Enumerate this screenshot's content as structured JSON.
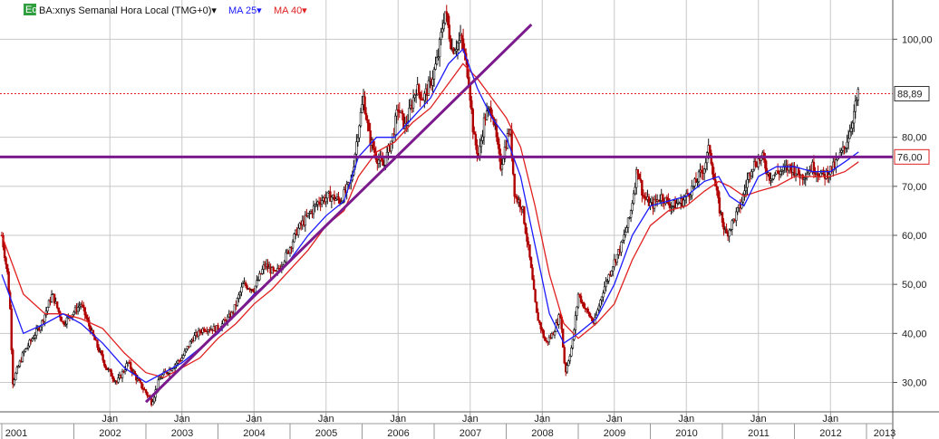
{
  "header": {
    "badge": "Eq",
    "symbol_label": "BA:xnys Semanal Hora Local (TMG+0)▾",
    "ma25_label": "MA 25▾",
    "ma40_label": "MA 40▾"
  },
  "colors": {
    "up_candle": "#111111",
    "down_candle": "#b00000",
    "ma25": "#1a1aff",
    "ma40": "#e02020",
    "trendline": "#7a1a8c",
    "support": "#7a1a8c",
    "price_line": "#e02020",
    "grid": "#c8c8c8",
    "badge_bg": "#2e9e3e"
  },
  "chart_data": {
    "type": "candlestick",
    "title": "BA:xnys Semanal Hora Local (TMG+0)",
    "ylim": [
      24,
      108
    ],
    "xlim": [
      2001.0,
      2013.2
    ],
    "grid": true,
    "y_ticks": [
      {
        "value": 30,
        "label": "30,00"
      },
      {
        "value": 40,
        "label": "40,00"
      },
      {
        "value": 50,
        "label": "50,00"
      },
      {
        "value": 60,
        "label": "60,00"
      },
      {
        "value": 70,
        "label": "70,00"
      },
      {
        "value": 80,
        "label": "80,00"
      },
      {
        "value": 100,
        "label": "100,00"
      }
    ],
    "x_year_labels": [
      {
        "t": 2001.0,
        "label": "2001"
      },
      {
        "t": 2002.0,
        "label": "2002"
      },
      {
        "t": 2003.0,
        "label": "2003"
      },
      {
        "t": 2004.0,
        "label": "2004"
      },
      {
        "t": 2005.0,
        "label": "2005"
      },
      {
        "t": 2006.0,
        "label": "2006"
      },
      {
        "t": 2007.0,
        "label": "2007"
      },
      {
        "t": 2008.0,
        "label": "2008"
      },
      {
        "t": 2009.0,
        "label": "2009"
      },
      {
        "t": 2010.0,
        "label": "2010"
      },
      {
        "t": 2011.0,
        "label": "2011"
      },
      {
        "t": 2012.0,
        "label": "2012"
      },
      {
        "t": 2013.0,
        "label": "2013"
      }
    ],
    "x_jan_labels": [
      {
        "t": 2002.0,
        "label": "Jan"
      },
      {
        "t": 2003.0,
        "label": "Jan"
      },
      {
        "t": 2004.0,
        "label": "Jan"
      },
      {
        "t": 2005.0,
        "label": "Jan"
      },
      {
        "t": 2006.0,
        "label": "Jan"
      },
      {
        "t": 2007.0,
        "label": "Jan"
      },
      {
        "t": 2008.0,
        "label": "Jan"
      },
      {
        "t": 2009.0,
        "label": "Jan"
      },
      {
        "t": 2010.0,
        "label": "Jan"
      },
      {
        "t": 2011.0,
        "label": "Jan"
      },
      {
        "t": 2012.0,
        "label": "Jan"
      }
    ],
    "price_path": [
      [
        2001.0,
        60
      ],
      [
        2001.08,
        52
      ],
      [
        2001.12,
        44
      ],
      [
        2001.15,
        30
      ],
      [
        2001.3,
        36
      ],
      [
        2001.55,
        42
      ],
      [
        2001.7,
        48
      ],
      [
        2001.85,
        42
      ],
      [
        2002.1,
        46
      ],
      [
        2002.25,
        40
      ],
      [
        2002.45,
        33
      ],
      [
        2002.6,
        30
      ],
      [
        2002.75,
        34
      ],
      [
        2002.9,
        30
      ],
      [
        2003.0,
        28
      ],
      [
        2003.08,
        26
      ],
      [
        2003.2,
        31
      ],
      [
        2003.35,
        33
      ],
      [
        2003.5,
        35
      ],
      [
        2003.65,
        39
      ],
      [
        2003.8,
        41
      ],
      [
        2004.0,
        41
      ],
      [
        2004.2,
        44
      ],
      [
        2004.35,
        50
      ],
      [
        2004.5,
        49
      ],
      [
        2004.65,
        54
      ],
      [
        2004.8,
        52
      ],
      [
        2004.95,
        56
      ],
      [
        2005.1,
        61
      ],
      [
        2005.25,
        64
      ],
      [
        2005.4,
        67
      ],
      [
        2005.55,
        68
      ],
      [
        2005.7,
        67
      ],
      [
        2005.85,
        71
      ],
      [
        2005.95,
        82
      ],
      [
        2006.02,
        88
      ],
      [
        2006.1,
        80
      ],
      [
        2006.2,
        76
      ],
      [
        2006.3,
        74
      ],
      [
        2006.42,
        80
      ],
      [
        2006.5,
        86
      ],
      [
        2006.6,
        82
      ],
      [
        2006.75,
        90
      ],
      [
        2006.85,
        88
      ],
      [
        2006.95,
        91
      ],
      [
        2007.05,
        96
      ],
      [
        2007.15,
        106
      ],
      [
        2007.25,
        98
      ],
      [
        2007.38,
        100
      ],
      [
        2007.48,
        92
      ],
      [
        2007.55,
        80
      ],
      [
        2007.62,
        76
      ],
      [
        2007.7,
        84
      ],
      [
        2007.8,
        86
      ],
      [
        2007.92,
        74
      ],
      [
        2008.05,
        82
      ],
      [
        2008.12,
        68
      ],
      [
        2008.22,
        66
      ],
      [
        2008.32,
        56
      ],
      [
        2008.42,
        44
      ],
      [
        2008.55,
        38
      ],
      [
        2008.65,
        40
      ],
      [
        2008.75,
        44
      ],
      [
        2008.82,
        32
      ],
      [
        2008.92,
        38
      ],
      [
        2009.0,
        48
      ],
      [
        2009.1,
        45
      ],
      [
        2009.22,
        42
      ],
      [
        2009.35,
        49
      ],
      [
        2009.48,
        54
      ],
      [
        2009.6,
        58
      ],
      [
        2009.72,
        64
      ],
      [
        2009.82,
        74
      ],
      [
        2009.9,
        68
      ],
      [
        2010.02,
        66
      ],
      [
        2010.15,
        68
      ],
      [
        2010.3,
        66
      ],
      [
        2010.45,
        67
      ],
      [
        2010.6,
        70
      ],
      [
        2010.75,
        74
      ],
      [
        2010.82,
        78
      ],
      [
        2010.88,
        72
      ],
      [
        2010.95,
        66
      ],
      [
        2011.05,
        60
      ],
      [
        2011.12,
        62
      ],
      [
        2011.25,
        66
      ],
      [
        2011.4,
        74
      ],
      [
        2011.55,
        76
      ],
      [
        2011.65,
        72
      ],
      [
        2011.8,
        73
      ],
      [
        2011.95,
        74
      ],
      [
        2012.1,
        72
      ],
      [
        2012.25,
        74
      ],
      [
        2012.4,
        72
      ],
      [
        2012.55,
        74
      ],
      [
        2012.7,
        78
      ],
      [
        2012.78,
        82
      ],
      [
        2012.84,
        86
      ],
      [
        2012.89,
        88.9
      ]
    ],
    "ma25_path": [
      [
        2001.0,
        52
      ],
      [
        2001.3,
        40
      ],
      [
        2001.6,
        42
      ],
      [
        2001.85,
        44
      ],
      [
        2002.1,
        42
      ],
      [
        2002.4,
        38
      ],
      [
        2002.7,
        33
      ],
      [
        2003.0,
        30
      ],
      [
        2003.25,
        32
      ],
      [
        2003.5,
        34
      ],
      [
        2003.75,
        37
      ],
      [
        2004.0,
        40
      ],
      [
        2004.25,
        44
      ],
      [
        2004.5,
        48
      ],
      [
        2004.75,
        51
      ],
      [
        2005.0,
        55
      ],
      [
        2005.25,
        60
      ],
      [
        2005.5,
        64
      ],
      [
        2005.75,
        67
      ],
      [
        2005.95,
        76
      ],
      [
        2006.2,
        80
      ],
      [
        2006.45,
        80
      ],
      [
        2006.7,
        84
      ],
      [
        2006.95,
        88
      ],
      [
        2007.2,
        95
      ],
      [
        2007.4,
        98
      ],
      [
        2007.6,
        90
      ],
      [
        2007.8,
        84
      ],
      [
        2008.0,
        80
      ],
      [
        2008.2,
        72
      ],
      [
        2008.4,
        58
      ],
      [
        2008.6,
        44
      ],
      [
        2008.8,
        38
      ],
      [
        2009.0,
        40
      ],
      [
        2009.25,
        43
      ],
      [
        2009.5,
        50
      ],
      [
        2009.75,
        60
      ],
      [
        2010.0,
        66
      ],
      [
        2010.25,
        67
      ],
      [
        2010.5,
        68
      ],
      [
        2010.75,
        71
      ],
      [
        2010.95,
        72
      ],
      [
        2011.1,
        68
      ],
      [
        2011.3,
        66
      ],
      [
        2011.5,
        72
      ],
      [
        2011.75,
        74
      ],
      [
        2012.0,
        74
      ],
      [
        2012.25,
        73
      ],
      [
        2012.5,
        73
      ],
      [
        2012.7,
        75
      ],
      [
        2012.89,
        77
      ]
    ],
    "ma40_path": [
      [
        2001.0,
        60
      ],
      [
        2001.3,
        48
      ],
      [
        2001.6,
        44
      ],
      [
        2001.85,
        44
      ],
      [
        2002.1,
        43
      ],
      [
        2002.4,
        41
      ],
      [
        2002.7,
        36
      ],
      [
        2003.0,
        32
      ],
      [
        2003.25,
        31
      ],
      [
        2003.5,
        33
      ],
      [
        2003.75,
        35
      ],
      [
        2004.0,
        39
      ],
      [
        2004.25,
        42
      ],
      [
        2004.5,
        46
      ],
      [
        2004.75,
        49
      ],
      [
        2005.0,
        53
      ],
      [
        2005.25,
        57
      ],
      [
        2005.5,
        62
      ],
      [
        2005.75,
        65
      ],
      [
        2005.95,
        72
      ],
      [
        2006.2,
        77
      ],
      [
        2006.45,
        79
      ],
      [
        2006.7,
        83
      ],
      [
        2006.95,
        86
      ],
      [
        2007.2,
        91
      ],
      [
        2007.4,
        95
      ],
      [
        2007.6,
        92
      ],
      [
        2007.8,
        88
      ],
      [
        2008.0,
        84
      ],
      [
        2008.2,
        78
      ],
      [
        2008.4,
        66
      ],
      [
        2008.6,
        52
      ],
      [
        2008.8,
        42
      ],
      [
        2009.0,
        39
      ],
      [
        2009.25,
        42
      ],
      [
        2009.5,
        46
      ],
      [
        2009.75,
        55
      ],
      [
        2010.0,
        62
      ],
      [
        2010.25,
        65
      ],
      [
        2010.5,
        66
      ],
      [
        2010.75,
        69
      ],
      [
        2010.95,
        71
      ],
      [
        2011.1,
        70
      ],
      [
        2011.3,
        68
      ],
      [
        2011.5,
        69
      ],
      [
        2011.75,
        70
      ],
      [
        2012.0,
        72
      ],
      [
        2012.25,
        72
      ],
      [
        2012.5,
        72
      ],
      [
        2012.7,
        73
      ],
      [
        2012.89,
        75
      ]
    ],
    "trendline": {
      "from": [
        2003.0,
        26
      ],
      "to": [
        2008.35,
        103
      ]
    },
    "support_level": {
      "value": 76.0,
      "label": "76,00"
    },
    "last_price": {
      "value": 88.89,
      "label": "88,89"
    }
  }
}
